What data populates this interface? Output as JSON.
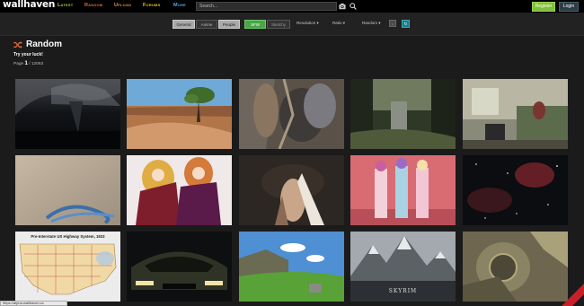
{
  "header": {
    "logo": "wallhaven",
    "nav": [
      "Latest",
      "Random",
      "Upload",
      "Forums",
      "More"
    ],
    "search_placeholder": "Search...",
    "register_label": "Register",
    "login_label": "Login"
  },
  "filters": {
    "categories": [
      "General",
      "Anime",
      "People"
    ],
    "purity": [
      "SFW",
      "Sketchy"
    ],
    "resolution_label": "Resolution",
    "ratio_label": "Ratio",
    "sort_label": "Random",
    "active_categories": [
      "General",
      "People"
    ],
    "active_purity": [
      "SFW"
    ]
  },
  "heading": {
    "title": "Random",
    "subtitle": "Try your luck!",
    "page_prefix": "Page",
    "page_current": "1",
    "page_total": "12063"
  },
  "thumbnails": {
    "map_title": "Pre-Interstate US Highway System, 1933",
    "skyrim_label": "SKYRIM"
  },
  "status_bar": {
    "text": "https://alpha.wallhaven.cc"
  },
  "colors": {
    "nav_latest": "#9fd641",
    "nav_random": "#e56a38",
    "nav_upload": "#f08d49",
    "nav_forums": "#e7c03c",
    "nav_more": "#56a9e2",
    "register": "#7fbf3a",
    "sfw": "#48a548"
  }
}
